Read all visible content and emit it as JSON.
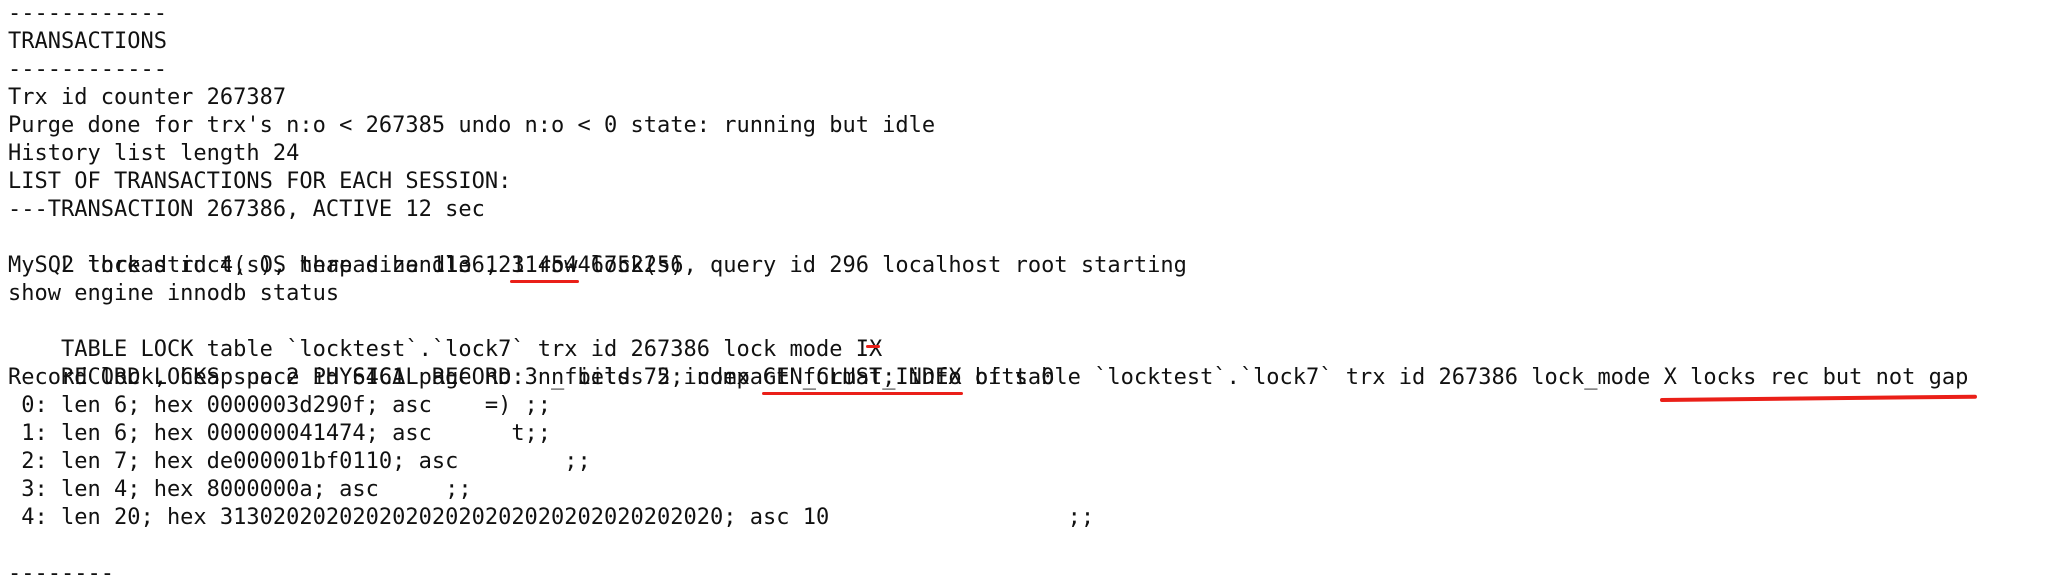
{
  "terminal": {
    "lines": {
      "l01": "------------",
      "l02": "TRANSACTIONS",
      "l03": "------------",
      "l04": "Trx id counter 267387",
      "l05": "Purge done for trx's n:o < 267385 undo n:o < 0 state: running but idle",
      "l06": "History list length 24",
      "l07": "LIST OF TRANSACTIONS FOR EACH SESSION:",
      "l08": "---TRANSACTION 267386, ACTIVE 12 sec",
      "l09_pre": "2 lock struct(s), heap size 1136, ",
      "l09_mark": "1 row",
      "l09_post": " lock(s)",
      "l10": "MySQL thread id 4, OS thread handle 123145446752256, query id 296 localhost root starting",
      "l11": "show engine innodb status",
      "l12_pre": "TABLE LOCK table `locktest`.`lock7` trx id 267386 lock mode ",
      "l12_mark": "IX",
      "l13_pre": "RECORD LOCKS space id 6461 page no 3 n bits 72 index ",
      "l13_mark1": "GEN_CLUST_INDEX",
      "l13_mid": " of table `locktest`.`lock7` trx id 267386 lock_mode ",
      "l13_mark2": "X locks rec but not gap",
      "l14": "Record lock, heap no 2 PHYSICAL RECORD: n_fields 5; compact format; info bits 0",
      "l15": " 0: len 6; hex 0000003d290f; asc    =) ;;",
      "l16": " 1: len 6; hex 000000041474; asc      t;;",
      "l17": " 2: len 7; hex de000001bf0110; asc        ;;",
      "l18": " 3: len 4; hex 8000000a; asc     ;;",
      "l19": " 4: len 20; hex 31302020202020202020202020202020202020; asc 10                  ;;",
      "l20": "--------"
    }
  },
  "colors": {
    "text": "#111111",
    "background": "#ffffff",
    "annotation": "#ea1f18"
  }
}
